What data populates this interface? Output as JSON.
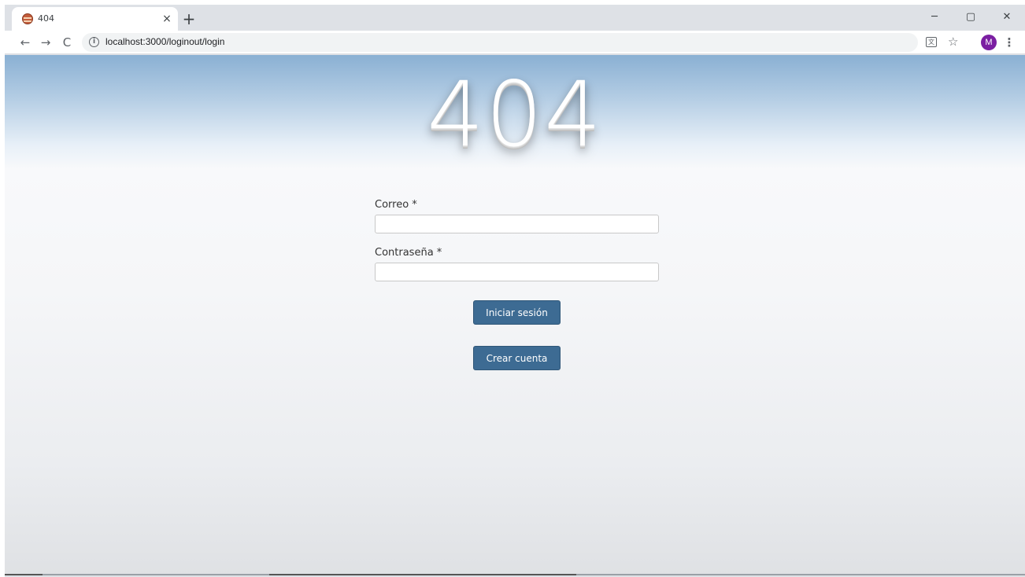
{
  "browser": {
    "tab": {
      "title": "404",
      "close_glyph": "×"
    },
    "new_tab_glyph": "+",
    "window_controls": {
      "minimize": "─",
      "restore": "▢",
      "close": "✕"
    },
    "nav": {
      "back": "←",
      "forward": "→",
      "reload": "C"
    },
    "address_bar": {
      "url": "localhost:3000/loginout/login",
      "info_glyph": "i"
    },
    "translate_glyph": "文",
    "bookmark_glyph": "☆",
    "profile_initial": "M",
    "menu_glyph": "⋮",
    "colors": {
      "profile_avatar": "#7b1fa2"
    }
  },
  "page": {
    "hero_text": "404",
    "form": {
      "email_label": "Correo *",
      "password_label": "Contraseña *",
      "email_value": "",
      "password_value": "",
      "login_button": "Iniciar sesión",
      "create_account_button": "Crear cuenta"
    },
    "colors": {
      "button": "#3d6b93",
      "sky_top": "#8ab0d3"
    }
  }
}
